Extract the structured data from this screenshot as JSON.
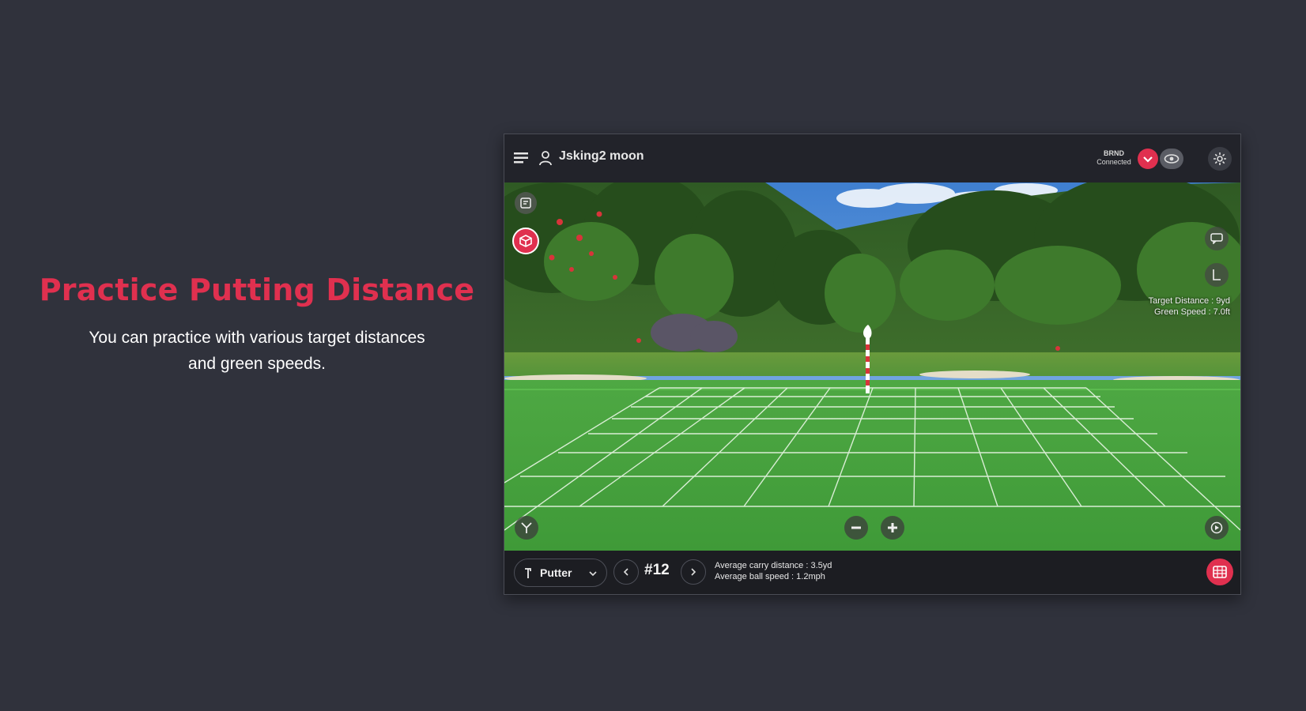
{
  "promo": {
    "title": "Practice Putting Distance",
    "desc_line1": "You can practice with various target distances",
    "desc_line2": "and green speeds."
  },
  "topbar": {
    "username": "Jsking2 moon",
    "device_name": "BRND",
    "device_status": "Connected"
  },
  "overlay": {
    "target_distance": "Target Distance : 9yd",
    "green_speed": "Green Speed : 7.0ft"
  },
  "bottombar": {
    "club": "Putter",
    "hole": "#12",
    "avg_carry": "Average carry distance : 3.5yd",
    "avg_ball_speed": "Average ball speed : 1.2mph"
  },
  "colors": {
    "accent": "#e0304f",
    "background": "#30323c",
    "green": "#45a83e"
  },
  "icons": [
    "menu-icon",
    "user-icon",
    "check-icon",
    "eye-icon",
    "settings-icon",
    "info-icon",
    "box-icon",
    "chat-icon",
    "flag-icon",
    "club-icon",
    "minus-icon",
    "plus-icon",
    "record-icon",
    "chevron-down-icon",
    "chevron-left-icon",
    "chevron-right-icon",
    "scorecard-icon"
  ]
}
